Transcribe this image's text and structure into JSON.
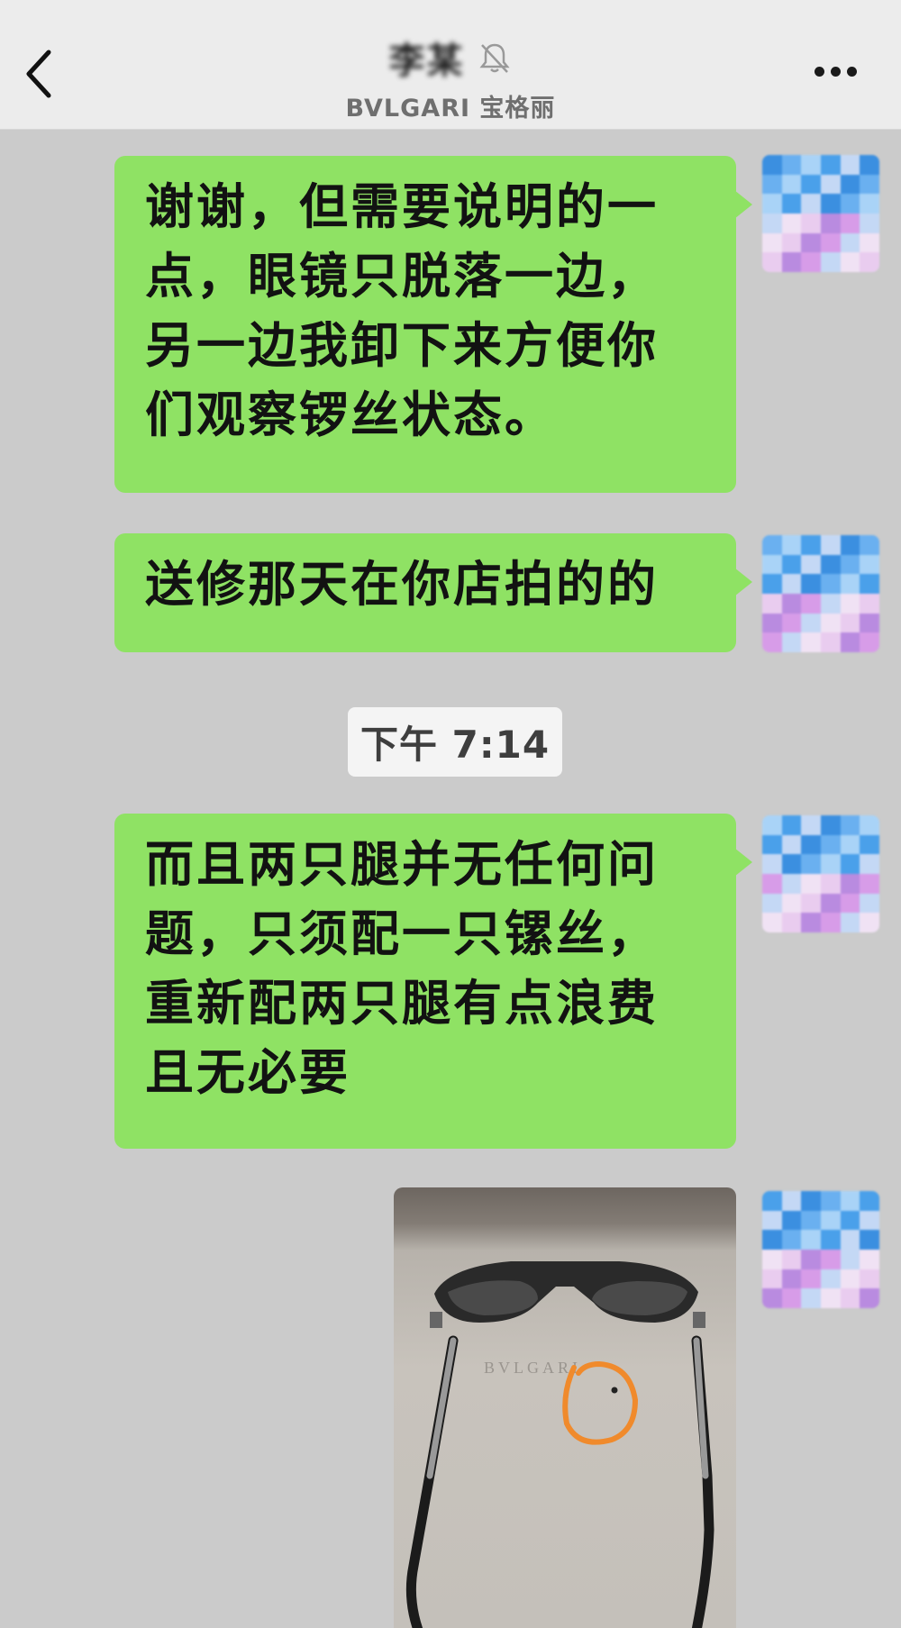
{
  "header": {
    "contact_name": "李某",
    "subtitle": "BVLGARI 宝格丽",
    "icons": {
      "back": "chevron-left-icon",
      "mute": "bell-off-icon",
      "more": "more-dots-icon"
    }
  },
  "messages": [
    {
      "type": "text",
      "text": "谢谢，但需要说明的一点，眼镜只脱落一边，另一边我卸下来方便你们观察锣丝状态。"
    },
    {
      "type": "text",
      "text": "送修那天在你店拍的的"
    },
    {
      "type": "timestamp",
      "text": "下午 7:14"
    },
    {
      "type": "text",
      "text": "而且两只腿并无任何问题，只须配一只镙丝，重新配两只腿有点浪费且无必要"
    },
    {
      "type": "image",
      "caption": "BVLGARI"
    }
  ],
  "colors": {
    "bubble": "#8fe264",
    "chat_bg": "#cbcbcb",
    "header_bg": "#ececec",
    "circle_mark": "#f08a2c"
  }
}
